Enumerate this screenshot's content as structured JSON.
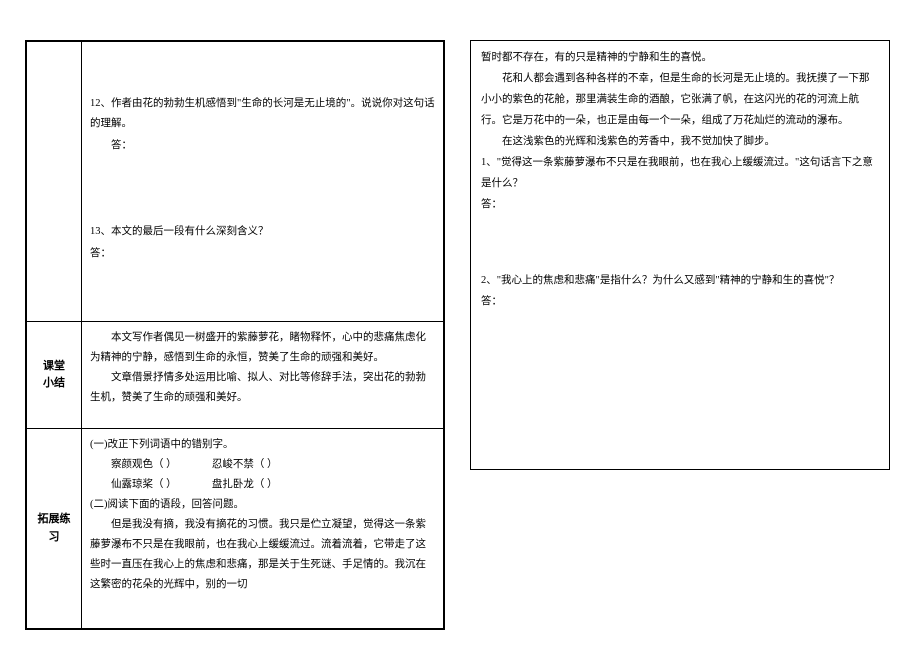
{
  "left": {
    "section1": {
      "q12": "12、作者由花的勃勃生机感悟到\"生命的长河是无止境的\"。说说你对这句话的理解。",
      "q12_ans": "答：",
      "q13": "13、本文的最后一段有什么深刻含义？",
      "q13_ans": "答："
    },
    "section2_label": "课堂\n小结",
    "section2": {
      "p1": "本文写作者偶见一树盛开的紫藤萝花，睹物释怀，心中的悲痛焦虑化为精神的宁静，感悟到生命的永恒，赞美了生命的顽强和美好。",
      "p2": "文章借景抒情多处运用比喻、拟人、对比等修辞手法，突出花的勃勃生机，赞美了生命的顽强和美好。"
    },
    "section3_label": "拓展练习",
    "section3": {
      "intro1": "(一)改正下列词语中的错别字。",
      "row1a": "察颜观色（    ）",
      "row1b": "忍峻不禁（    ）",
      "row2a": "仙露琼桨（    ）",
      "row2b": "盘扎卧龙（    ）",
      "intro2": "(二)阅读下面的语段，回答问题。",
      "passage": "但是我没有摘，我没有摘花的习惯。我只是伫立凝望，觉得这一条紫藤萝瀑布不只是在我眼前，也在我心上缓缓流过。流着流着，它带走了这些时一直压在我心上的焦虑和悲痛，那是关于生死谜、手足情的。我沉在这繁密的花朵的光辉中，别的一切"
    }
  },
  "right": {
    "passage": {
      "p1": "暂时都不存在，有的只是精神的宁静和生的喜悦。",
      "p2": "花和人都会遇到各种各样的不幸，但是生命的长河是无止境的。我抚摸了一下那小小的紫色的花舱，那里满装生命的酒酿，它张满了帆，在这闪光的花的河流上航行。它是万花中的一朵，也正是由每一个一朵，组成了万花灿烂的流动的瀑布。",
      "p3": "在这浅紫色的光辉和浅紫色的芳香中，我不觉加快了脚步。"
    },
    "q1": "1、\"觉得这一条紫藤萝瀑布不只是在我眼前，也在我心上缓缓流过。\"这句话言下之意是什么？",
    "q1_ans": "答：",
    "q2": "2、\"我心上的焦虑和悲痛\"是指什么？为什么又感到\"精神的宁静和生的喜悦\"？",
    "q2_ans": "答："
  }
}
